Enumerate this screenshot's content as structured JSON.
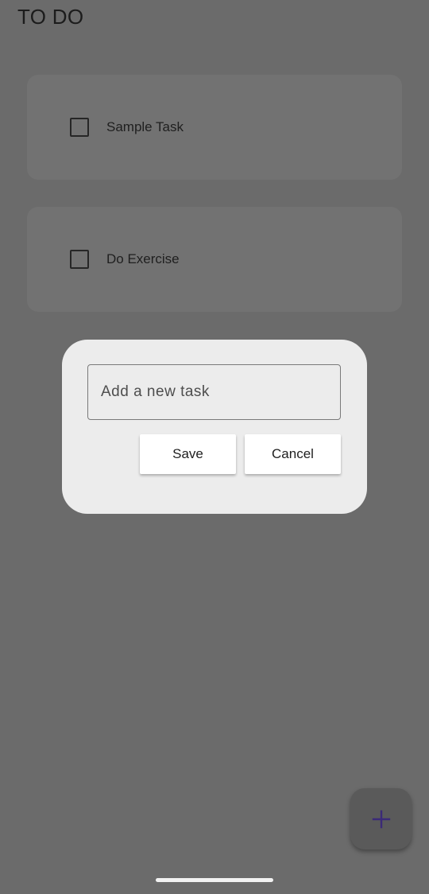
{
  "app": {
    "title": "TO DO"
  },
  "tasks": [
    {
      "label": "Sample Task",
      "checked": false
    },
    {
      "label": "Do Exercise",
      "checked": false
    }
  ],
  "dialog": {
    "input_placeholder": "Add a new task",
    "input_value": "",
    "save_label": "Save",
    "cancel_label": "Cancel"
  },
  "fab": {
    "icon": "plus-icon",
    "icon_color": "#3b2a78"
  },
  "colors": {
    "scrim_background": "#6b6b6b",
    "dialog_background": "#ececec",
    "button_background": "#ffffff"
  }
}
